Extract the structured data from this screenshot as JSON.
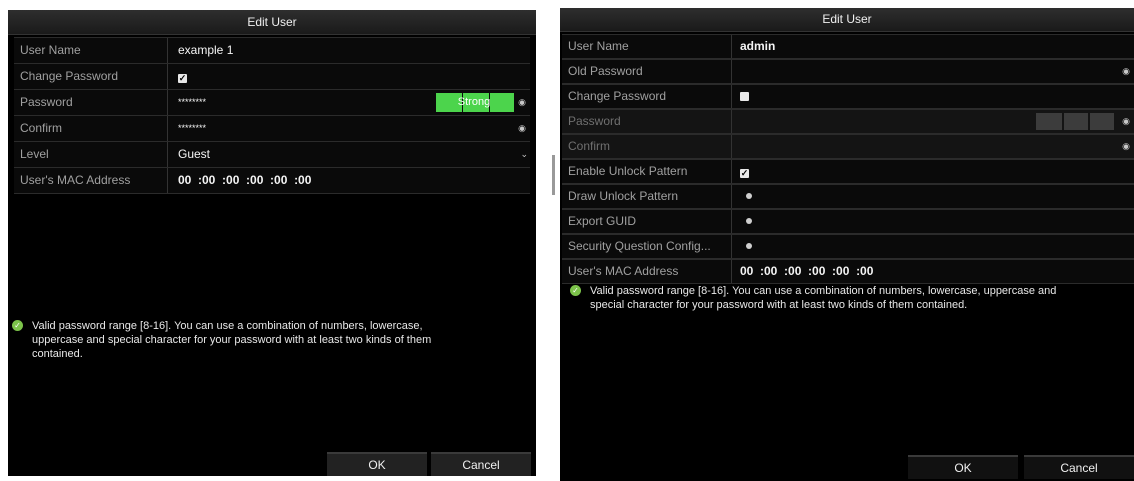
{
  "left": {
    "title": "Edit User",
    "rows": {
      "username_label": "User Name",
      "username_value": "example 1",
      "change_password_label": "Change Password",
      "password_label": "Password",
      "password_value": "********",
      "strength_label": "Strong",
      "confirm_label": "Confirm",
      "confirm_value": "********",
      "level_label": "Level",
      "level_value": "Guest",
      "mac_label": "User's MAC Address",
      "mac_value": "00  :00  :00  :00  :00  :00"
    },
    "message": "Valid password range [8-16]. You can use a combination of numbers, lowercase, uppercase and special character for your password with at least two kinds of them contained.",
    "ok_label": "OK",
    "cancel_label": "Cancel"
  },
  "right": {
    "title": "Edit User",
    "rows": {
      "username_label": "User Name",
      "username_value": "admin",
      "old_password_label": "Old Password",
      "change_password_label": "Change Password",
      "password_label": "Password",
      "confirm_label": "Confirm",
      "enable_unlock_label": "Enable Unlock Pattern",
      "draw_unlock_label": "Draw Unlock Pattern",
      "export_guid_label": "Export GUID",
      "security_question_label": "Security Question Config...",
      "mac_label": "User's MAC Address",
      "mac_value": "00  :00  :00  :00  :00  :00"
    },
    "message": "Valid password range [8-16]. You can use a combination of numbers, lowercase, uppercase and special character for your password with at least two kinds of them contained.",
    "ok_label": "OK",
    "cancel_label": "Cancel"
  },
  "colors": {
    "strength_green": "#4cd44c",
    "valid_icon_green": "#7cc34a",
    "dialog_bg": "#000000"
  }
}
